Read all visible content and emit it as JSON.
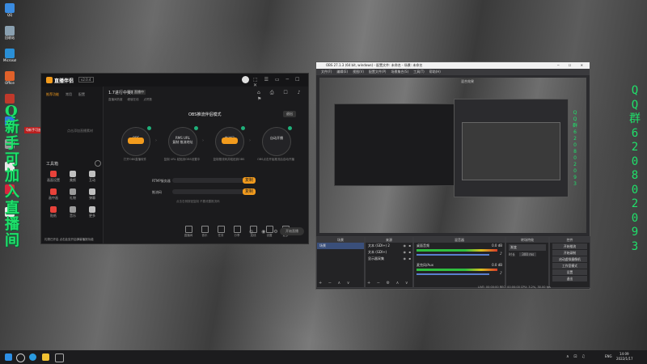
{
  "desktop": {
    "icons": [
      {
        "label": "QQ",
        "color": "#3a8be0"
      },
      {
        "label": "回收站",
        "color": "#8aa0b0"
      },
      {
        "label": "Microsoft Edge",
        "color": "#2a8fd6"
      },
      {
        "label": "Office",
        "color": "#e0612a"
      },
      {
        "label": "",
        "color": "#c0392b"
      },
      {
        "label": "",
        "color": "#2d7be0"
      },
      {
        "label": "",
        "color": "#9a9a9a"
      },
      {
        "label": "",
        "color": "#e8e8e8"
      },
      {
        "label": "",
        "color": "#d7263d"
      },
      {
        "label": "",
        "color": "#e8e8e8"
      }
    ],
    "overlay_left_text": "Q新手可加入直播间",
    "overlay_green": [
      "Q",
      "新",
      "手",
      "可",
      "加",
      "入",
      "直",
      "播",
      "间"
    ],
    "qq_group_chars": [
      "Q",
      "Q",
      "群",
      "6",
      "2",
      "0",
      "8",
      "0",
      "2",
      "0",
      "9",
      "3"
    ]
  },
  "app": {
    "logo": "直播伴侣",
    "version": "v2.0.4",
    "tabs": [
      "推荐功能",
      "常用",
      "配置"
    ],
    "sidebar_hint": "点击添加直播素材",
    "tools_label": "工具箱",
    "tools": [
      "画面设置",
      "美颜",
      "互动",
      "画中画",
      "礼物",
      "弹幕",
      "贴纸",
      "音乐",
      "更多"
    ],
    "bottom_left_text": "礼物已开启  点击此处开启弹幕播报功能",
    "room_title": "1.7进行中赛制",
    "room_status": "直播中",
    "room_stats": [
      "直播间热度",
      "峰值在线",
      "点赞数"
    ],
    "panel_title": "OBS推流伴侣模式",
    "panel_btn": "退出",
    "steps": [
      {
        "name": "OBS",
        "desc": "打开OBS直播软件"
      },
      {
        "name": "RMS URL\n复制 推流地址",
        "desc": "复制 URL 粘贴到OBS设置中"
      },
      {
        "name": "推流码",
        "desc": "复制推流码并粘贴到OBS"
      },
      {
        "name": "自动开播",
        "desc": "OBS点击开始推流后自动开播"
      }
    ],
    "field_server_label": "RTMP服务器",
    "field_key_label": "推流码",
    "copy_btn": "复制",
    "field_hint": "点击右侧按钮复制 不要泄露推流码",
    "bottom_tools": [
      "直播间",
      "音乐",
      "任务",
      "分享",
      "连线",
      "设置",
      "更多"
    ],
    "start_btn": "开始直播"
  },
  "obs": {
    "title": "OBS 27.1.3 (64 bit, windows) - 配置文件: 未命名 - 场景: 未命名",
    "menu": [
      "文件(F)",
      "编辑(E)",
      "视图(V)",
      "配置文件(P)",
      "场景集合(S)",
      "工具(T)",
      "帮助(H)"
    ],
    "scenes_header": "场景",
    "sources_header": "来源",
    "sources": [
      "文本 (GDI+) 2",
      "文本 (GDI+)",
      "显示器采集"
    ],
    "scene_item": "场景",
    "mixer_header": "混音器",
    "mixer_tracks": [
      {
        "name": "桌面音频",
        "db": "0.0 dB"
      },
      {
        "name": "麦克风/Aux",
        "db": "0.0 dB"
      }
    ],
    "transition_header": "转场特效",
    "transition_value": "渐变",
    "duration_label": "时长",
    "duration_value": "300 ms",
    "controls_header": "控件",
    "controls": [
      "开始推流",
      "开始录制",
      "启动虚拟摄像机",
      "工作室模式",
      "设置",
      "退出"
    ],
    "status": "LIVE: 00:00:00  REC: 00:00:00  CPU: 3.2%, 30.00 fps",
    "preview_label": "混合效果"
  },
  "taskbar": {
    "time": "14:09",
    "date": "2022/1/17",
    "lang": "ENG"
  }
}
